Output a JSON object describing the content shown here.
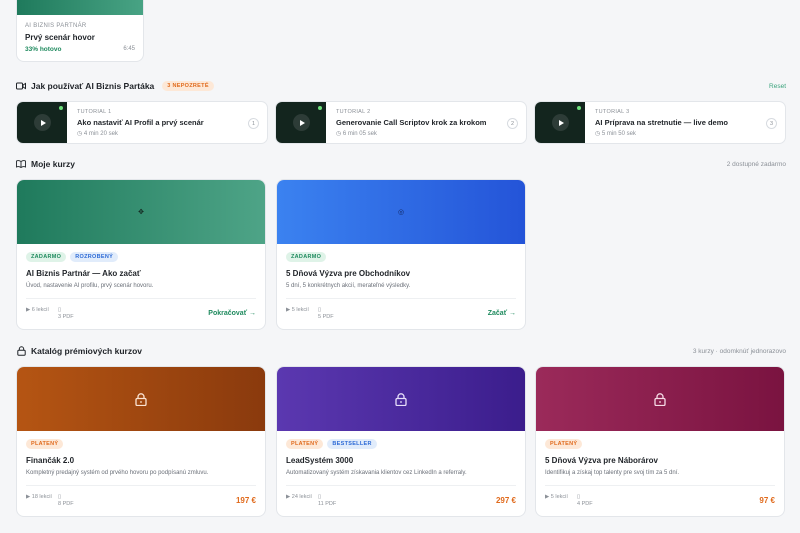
{
  "scenario_card": {
    "kicker": "AI BIZNIS PARTNÁR",
    "title": "Prvý scenár hovor",
    "progress": "33% hotovo",
    "duration": "6:45"
  },
  "tutorials_section": {
    "title": "Jak používať AI Biznis Partáka",
    "badge": "3 NEPOZRETÉ",
    "reset": "Reset",
    "items": [
      {
        "kicker": "TUTORIAL 1",
        "title": "Ako nastaviť AI Profil a prvý scenár",
        "duration": "4 min 20 sek",
        "num": "1"
      },
      {
        "kicker": "TUTORIAL 2",
        "title": "Generovanie Call Scriptov krok za krokom",
        "duration": "6 min 05 sek",
        "num": "2"
      },
      {
        "kicker": "TUTORIAL 3",
        "title": "AI Príprava na stretnutie — live demo",
        "duration": "5 min 50 sek",
        "num": "3"
      }
    ]
  },
  "my_courses": {
    "title": "Moje kurzy",
    "right": "2 dostupné zadarmo",
    "items": [
      {
        "tags": [
          "ZADARMO",
          "ROZROBENÝ"
        ],
        "title": "AI Biznis Partnár — Ako začať",
        "desc": "Úvod, nastavenie AI profilu, prvý scenár hovoru.",
        "lessons": "6 lekcií",
        "pdf": "3 PDF",
        "cta": "Pokračovať →",
        "gradient": [
          "#1f7a5c",
          "#4ea487"
        ]
      },
      {
        "tags": [
          "ZADARMO"
        ],
        "title": "5 Dňová Výzva pre Obchodníkov",
        "desc": "5 dní, 5 konkrétnych akcií, merateľné výsledky.",
        "lessons": "5 lekcií",
        "pdf": "5 PDF",
        "cta": "Začať →",
        "gradient": [
          "#3b82f0",
          "#2454d8"
        ]
      }
    ]
  },
  "catalog": {
    "title": "Katalóg prémiových kurzov",
    "right": "3 kurzy · odomknúť jednorazovo",
    "items": [
      {
        "tags": [
          "PLATENÝ"
        ],
        "title": "Finančák 2.0",
        "desc": "Kompletný predajný systém od prvého hovoru po podpísanú zmluvu.",
        "lessons": "18 lekcií",
        "pdf": "8 PDF",
        "price": "197 €",
        "gradient": [
          "#b55513",
          "#8a3a0d"
        ]
      },
      {
        "tags": [
          "PLATENÝ",
          "BESTSELLER"
        ],
        "title": "LeadSystém 3000",
        "desc": "Automatizovaný systém získavania klientov cez LinkedIn a referraly.",
        "lessons": "24 lekcií",
        "pdf": "11 PDF",
        "price": "297 €",
        "gradient": [
          "#5b38b0",
          "#3b1d8c"
        ]
      },
      {
        "tags": [
          "PLATENÝ"
        ],
        "title": "5 Dňová Výzva pre Náborárov",
        "desc": "Identifikuj a získaj top talenty pre svoj tím za 5 dní.",
        "lessons": "5 lekcií",
        "pdf": "4 PDF",
        "price": "97 €",
        "gradient": [
          "#9b2a5a",
          "#7a1340"
        ]
      }
    ]
  },
  "colors": {
    "accent_green": "#1f8a5e",
    "accent_orange": "#e06a1c",
    "accent_blue": "#2e6bd6"
  }
}
